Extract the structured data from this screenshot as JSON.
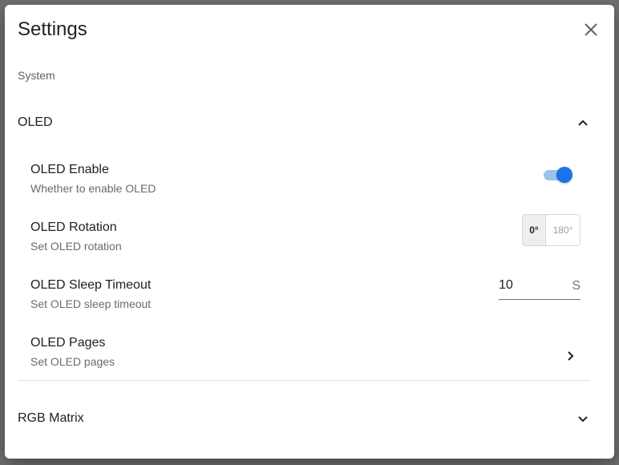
{
  "dialog": {
    "title": "Settings",
    "close_icon": "close-icon"
  },
  "section": {
    "label": "System"
  },
  "groups": {
    "oled": {
      "title": "OLED",
      "expanded": true,
      "chevron_icon": "chevron-up-icon",
      "items": {
        "enable": {
          "title": "OLED Enable",
          "subtitle": "Whether to enable OLED",
          "value": true
        },
        "rotation": {
          "title": "OLED Rotation",
          "subtitle": "Set OLED rotation",
          "options": [
            "0°",
            "180°"
          ],
          "selected": "0°"
        },
        "sleep_timeout": {
          "title": "OLED Sleep Timeout",
          "subtitle": "Set OLED sleep timeout",
          "value": "10",
          "unit": "S"
        },
        "pages": {
          "title": "OLED Pages",
          "subtitle": "Set OLED pages",
          "chevron_icon": "chevron-right-icon"
        }
      }
    },
    "rgb_matrix": {
      "title": "RGB Matrix",
      "expanded": false,
      "chevron_icon": "chevron-down-icon"
    }
  },
  "colors": {
    "accent": "#1a73e8",
    "track": "#9cc2ee",
    "backdrop": "#6f6f6f"
  }
}
